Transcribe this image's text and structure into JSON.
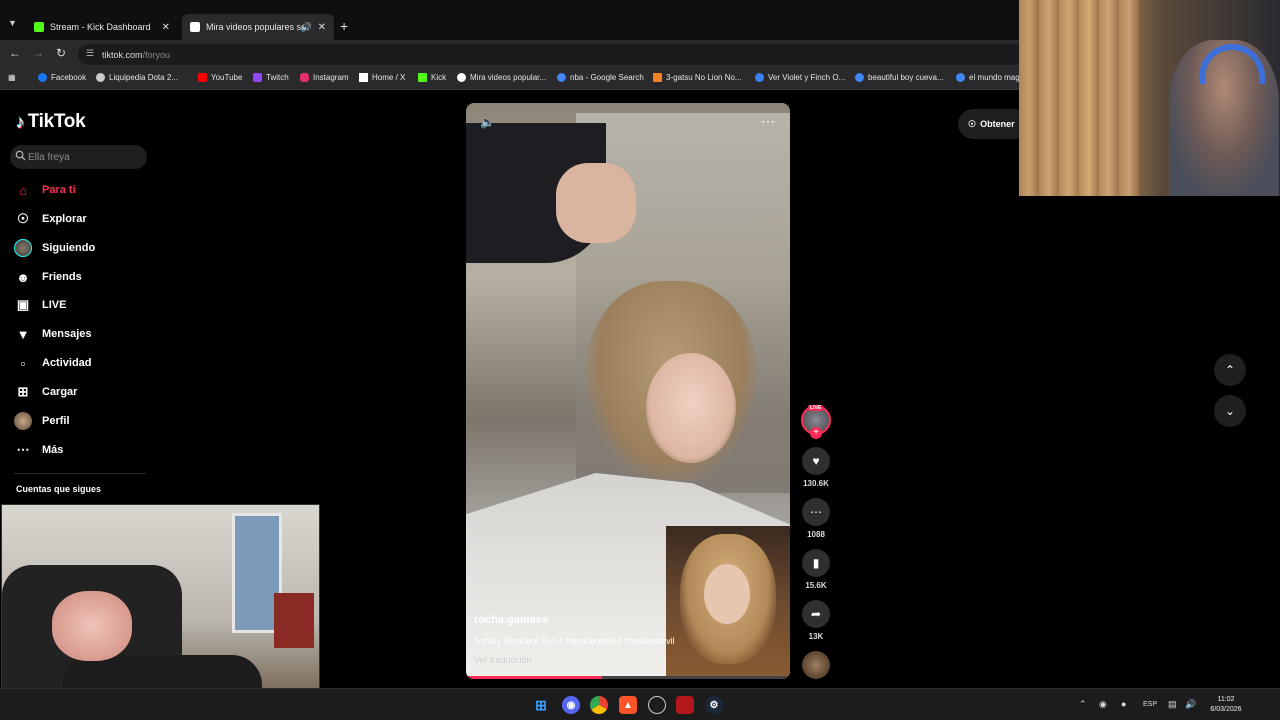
{
  "browser": {
    "tabs": [
      {
        "title": "Stream - Kick Dashboard",
        "active": false,
        "favicon_color": "#53fc18"
      },
      {
        "title": "Mira videos populares sele",
        "active": true,
        "favicon_color": "#ffffff"
      }
    ],
    "url": {
      "host": "tiktok.com",
      "path": "/foryou"
    },
    "bookmarks": [
      {
        "label": "Facebook",
        "color": "#1877f2"
      },
      {
        "label": "Liquipedia Dota 2...",
        "color": "#cccccc"
      },
      {
        "label": "YouTube",
        "color": "#ff0000"
      },
      {
        "label": "Twitch",
        "color": "#9146ff"
      },
      {
        "label": "Instagram",
        "color": "#e1306c"
      },
      {
        "label": "Home / X",
        "color": "#ffffff"
      },
      {
        "label": "Kick",
        "color": "#53fc18"
      },
      {
        "label": "Mira videos popular...",
        "color": "#ffffff"
      },
      {
        "label": "nba - Google Search",
        "color": "#4285f4"
      },
      {
        "label": "3-gatsu No Lion No...",
        "color": "#f58220"
      },
      {
        "label": "Ver Violet y Finch O...",
        "color": "#3b82f6"
      },
      {
        "label": "beautiful boy cueva...",
        "color": "#4285f4"
      },
      {
        "label": "el mundo mag",
        "color": "#4285f4"
      }
    ]
  },
  "tiktok": {
    "brand": "TikTok",
    "search_placeholder": "Ella freya",
    "nav": [
      {
        "label": "Para ti",
        "icon": "home-icon",
        "active": true
      },
      {
        "label": "Explorar",
        "icon": "compass-icon",
        "active": false
      },
      {
        "label": "Siguiendo",
        "icon": "following-avatar-icon",
        "active": false
      },
      {
        "label": "Friends",
        "icon": "friends-icon",
        "active": false
      },
      {
        "label": "LIVE",
        "icon": "live-tv-icon",
        "active": false
      },
      {
        "label": "Mensajes",
        "icon": "paper-plane-icon",
        "active": false
      },
      {
        "label": "Actividad",
        "icon": "activity-icon",
        "active": false
      },
      {
        "label": "Cargar",
        "icon": "upload-plus-icon",
        "active": false
      },
      {
        "label": "Perfil",
        "icon": "profile-avatar-icon",
        "active": false
      },
      {
        "label": "Más",
        "icon": "more-dots-icon",
        "active": false
      }
    ],
    "following_title": "Cuentas que sigues",
    "get_app": "Obtener",
    "video": {
      "author": "rocha.gamess",
      "caption": "Ashley Resident Evil 4 #residentevil4 #residentevil",
      "translate": "Ver traducción",
      "progress": 0.42
    },
    "actions": {
      "live_badge": "LIVE",
      "likes": "130.6K",
      "comments": "1088",
      "saves": "15.6K",
      "shares": "13K"
    }
  },
  "taskbar": {
    "lang": "ESP",
    "time": "11:02",
    "date": "6/03/2026"
  },
  "colors": {
    "accent": "#fe2c55",
    "background": "#000000"
  }
}
